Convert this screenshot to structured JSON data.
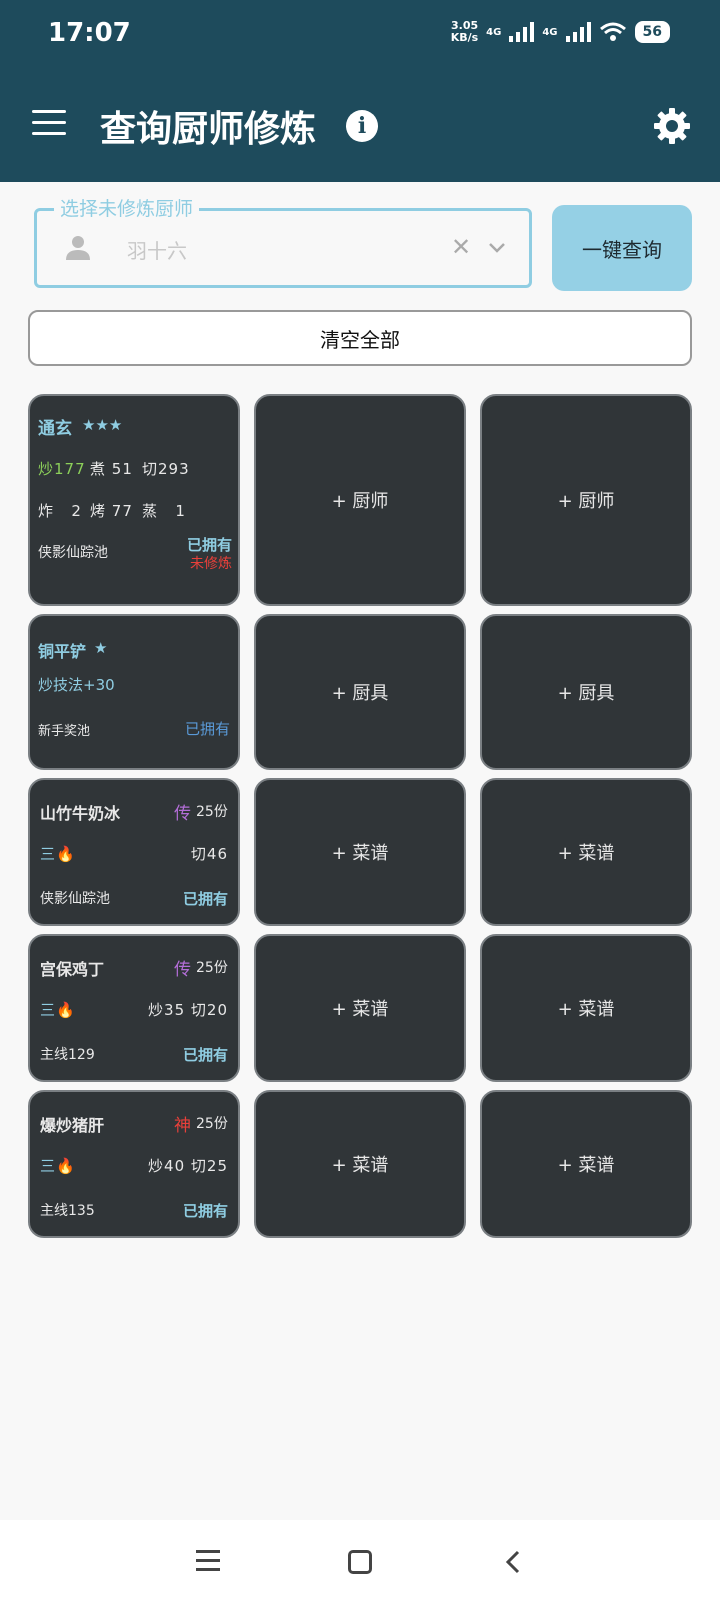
{
  "status": {
    "time": "17:07",
    "net_speed": "3.05",
    "net_unit": "KB/s",
    "net1": "4G",
    "net2": "4G",
    "battery": "56"
  },
  "header": {
    "title": "查询厨师修炼"
  },
  "select": {
    "legend": "选择未修炼厨师",
    "placeholder": "羽十六"
  },
  "buttons": {
    "query": "一键查询",
    "clear_all": "清空全部"
  },
  "chef": {
    "name": "通玄",
    "stars": "★★★",
    "stats1": [
      {
        "label": "炒",
        "value": "177"
      },
      {
        "label": "煮",
        "value": "51"
      },
      {
        "label": "切",
        "value": "293"
      }
    ],
    "stats2": [
      {
        "label": "炸",
        "value": "2"
      },
      {
        "label": "烤",
        "value": "77"
      },
      {
        "label": "蒸",
        "value": "1"
      }
    ],
    "source": "侠影仙踪池",
    "owned": "已拥有",
    "status": "未修炼"
  },
  "equip": {
    "name": "铜平铲",
    "stars": "★",
    "effect": "炒技法+30",
    "source": "新手奖池",
    "owned": "已拥有"
  },
  "recipes": [
    {
      "name": "山竹牛奶冰",
      "rarity": "传",
      "count": "25份",
      "level": "三🔥",
      "skill": "切46",
      "source": "侠影仙踪池",
      "owned": "已拥有"
    },
    {
      "name": "宫保鸡丁",
      "rarity": "传",
      "count": "25份",
      "level": "三🔥",
      "skill": "炒35 切20",
      "source": "主线129",
      "owned": "已拥有"
    },
    {
      "name": "爆炒猪肝",
      "rarity": "神",
      "count": "25份",
      "level": "三🔥",
      "skill": "炒40 切25",
      "source": "主线135",
      "owned": "已拥有"
    }
  ],
  "placeholders": {
    "chef": "+ 厨师",
    "equip": "+ 厨具",
    "recipe": "+ 菜谱"
  }
}
